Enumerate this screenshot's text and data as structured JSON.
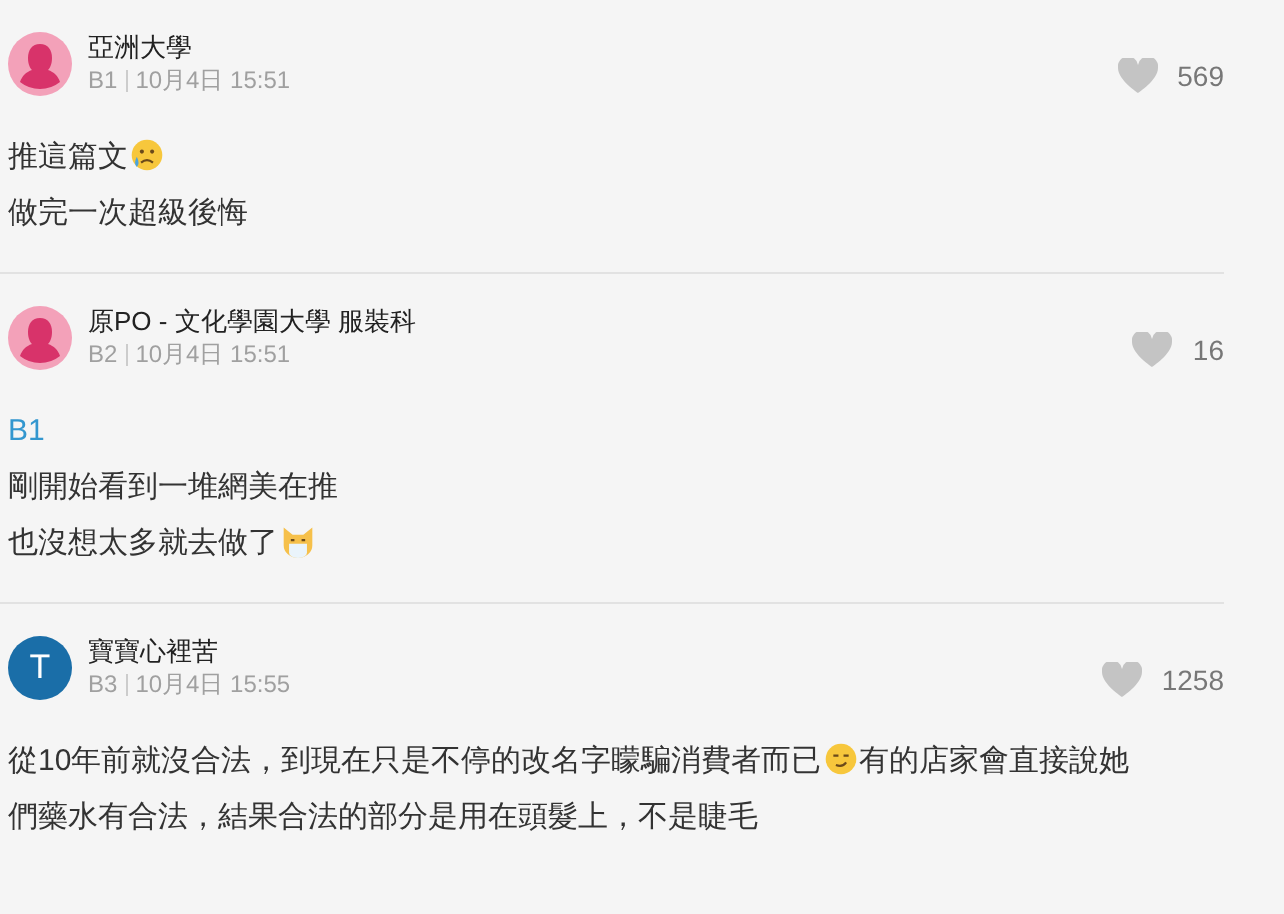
{
  "comments": [
    {
      "avatar": {
        "kind": "silhouette"
      },
      "author": "亞洲大學",
      "floor": "B1",
      "time": "10月4日 15:51",
      "likes": "569",
      "body": [
        [
          {
            "kind": "text",
            "text": "推這篇文"
          },
          {
            "kind": "sad_emoji"
          }
        ],
        [
          {
            "kind": "text",
            "text": "做完一次超級後悔"
          }
        ]
      ]
    },
    {
      "avatar": {
        "kind": "silhouette"
      },
      "author": "原PO - 文化學園大學 服裝科",
      "floor": "B2",
      "time": "10月4日 15:51",
      "likes": "16",
      "body": [
        [
          {
            "kind": "reply",
            "text": "B1"
          }
        ],
        [
          {
            "kind": "text",
            "text": "剛開始看到一堆網美在推"
          }
        ],
        [
          {
            "kind": "text",
            "text": "也沒想太多就去做了"
          },
          {
            "kind": "cat_emoji"
          }
        ]
      ]
    },
    {
      "avatar": {
        "kind": "letter",
        "letter": "T"
      },
      "author": "寶寶心裡苦",
      "floor": "B3",
      "time": "10月4日 15:55",
      "likes": "1258",
      "body": [
        [
          {
            "kind": "text",
            "text": "從10年前就沒合法，到現在只是不停的改名字矇騙消費者而已"
          },
          {
            "kind": "smirk_emoji"
          },
          {
            "kind": "text",
            "text": "有的店家會直接說她"
          }
        ],
        [
          {
            "kind": "text",
            "text": "們藥水有合法，結果合法的部分是用在頭髮上，不是睫毛"
          }
        ]
      ]
    }
  ]
}
